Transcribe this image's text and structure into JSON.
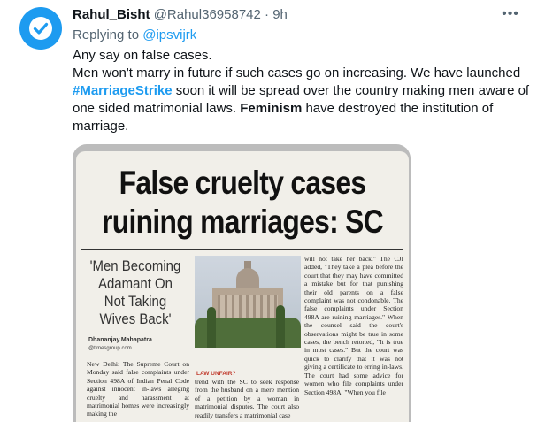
{
  "tweet": {
    "display_name": "Rahul_Bisht",
    "handle": "@Rahul36958742",
    "separator": "·",
    "time": "9h",
    "more_icon": "ellipsis-icon",
    "avatar_icon": "check-badge-icon",
    "accent_color": "#1d9bf0",
    "replying_prefix": "Replying to ",
    "replying_to": "@ipsvijrk",
    "body": {
      "line1": "Any say on false cases.",
      "part1": "Men won't marry in future if such cases go on increasing. We have launched ",
      "hashtag": "#MarriageStrike",
      "part2": " soon it will be spread over the country making men aware of one sided matrimonial laws. ",
      "bold_word": "Feminism",
      "part3": " have destroyed the institution of marriage."
    }
  },
  "clipping": {
    "headline_line1": "False cruelty cases",
    "headline_line2": "ruining marriages: SC",
    "pull_quote": "'Men Becoming Adamant On Not Taking Wives Back'",
    "byline": "Dhananjay.Mahapatra",
    "byline_email": "@timesgroup.com",
    "photo_label": "LAW UNFAIR?",
    "col1_text": "New Delhi: The Supreme Court on Monday said false complaints under Section 498A of Indian Penal Code against innocent in-laws alleging cruelty and harassment at matrimonial homes were increasingly making the",
    "col2_text": "trend with the SC to seek response from the husband on a mere mention of a petition by a woman in matrimonial disputes. The court also readily transfers a matrimonial case",
    "col3_text": "will not take her back.\" The CJI added, \"They take a plea before the court that they may have committed a mistake but for that punishing their old parents on a false complaint was not condonable. The false complaints under Section 498A are ruining marriages.\" When the counsel said the court's observations might be true in some cases, the bench retorted, \"It is true in most cases.\" But the court was quick to clarify that it was not giving a certificate to erring in-laws. The court had some advice for women who file complaints under Section 498A. \"When you file"
  }
}
